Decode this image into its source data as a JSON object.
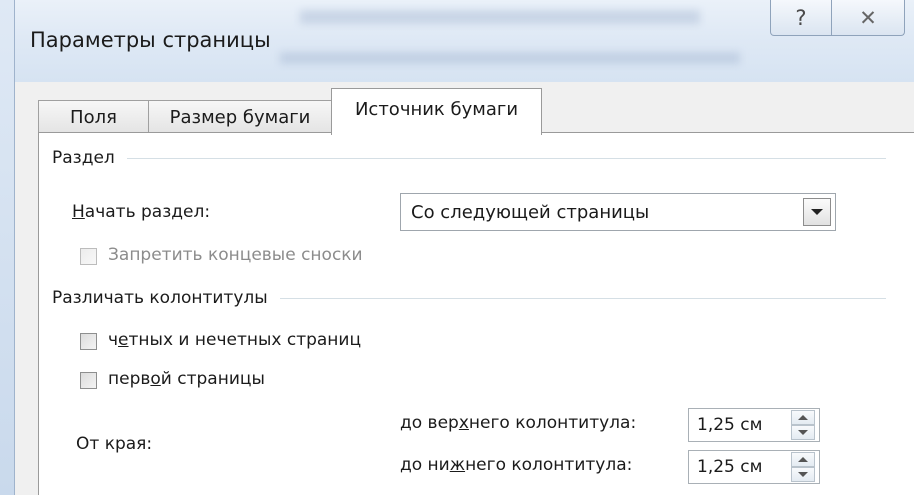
{
  "window": {
    "title": "Параметры страницы",
    "help_label": "?",
    "close_label": "✕"
  },
  "tabs": [
    {
      "label": "Поля",
      "active": false
    },
    {
      "label": "Размер бумаги",
      "active": false
    },
    {
      "label": "Источник бумаги",
      "active": true
    }
  ],
  "section": {
    "heading": "Раздел",
    "start_label_underlined": "Н",
    "start_label_rest": "ачать раздел:",
    "start_value": "Со следующей страницы",
    "suppress_endnotes_label": "Запретить концевые сноски",
    "suppress_endnotes_checked": false,
    "suppress_endnotes_enabled": false
  },
  "headers_footers": {
    "heading": "Различать колонтитулы",
    "odd_even_pre": "ч",
    "odd_even_u": "е",
    "odd_even_post": "тных и нечетных страниц",
    "odd_even_checked": false,
    "first_page_pre": "перв",
    "first_page_u": "о",
    "first_page_post": "й страницы",
    "first_page_checked": false
  },
  "from_edge": {
    "label": "От края:",
    "header_pre": "до вер",
    "header_u": "х",
    "header_post": "него колонтитула:",
    "header_value": "1,25 см",
    "footer_pre": "до ни",
    "footer_u": "ж",
    "footer_post": "него колонтитула:",
    "footer_value": "1,25 см"
  },
  "colors": {
    "titlebar": "#dfe9f5",
    "dialog_bg": "#f0f0f0",
    "panel_bg": "#ffffff"
  }
}
